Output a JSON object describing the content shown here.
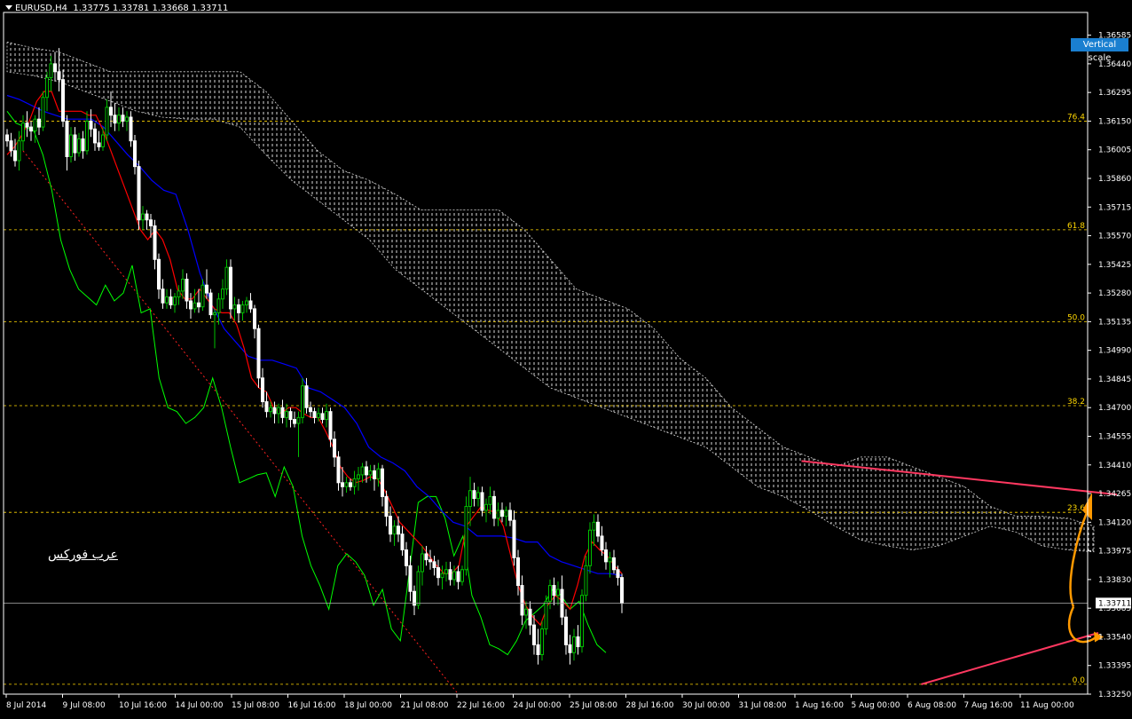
{
  "header": {
    "symbol": "EURUSD,H4",
    "ohlc": "1.33775 1.33781 1.33668 1.33711"
  },
  "vertical_scale_label": "Vertical scale",
  "watermark": "عرب فوركس",
  "colors": {
    "bg": "#000000",
    "bull": "#00c000",
    "bear": "#ffffff",
    "axis": "#ffffff",
    "tenkan": "#ff0000",
    "kijun": "#0000ff",
    "chikou": "#00ff00",
    "cloud": "#ffffff",
    "fib": "#ffd700",
    "trend": "#ff3860",
    "diag": "#ff2020",
    "arrow": "#ff9900",
    "price_line": "#b0b0b0"
  },
  "chart_data": {
    "type": "candlestick",
    "symbol": "EURUSD",
    "timeframe": "H4",
    "ylim": [
      1.3325,
      1.367
    ],
    "y_ticks": [
      1.36585,
      1.3644,
      1.36295,
      1.3615,
      1.36005,
      1.3586,
      1.35715,
      1.3557,
      1.35425,
      1.3528,
      1.35135,
      1.3499,
      1.34845,
      1.347,
      1.34555,
      1.3441,
      1.34265,
      1.3412,
      1.33975,
      1.3383,
      1.33685,
      1.3354,
      1.33395,
      1.3325
    ],
    "y_tick_labels": [
      "1.36585",
      "1.36440",
      "1.36295",
      "1.36150",
      "1.36005",
      "1.35860",
      "1.35715",
      "1.35570",
      "1.35425",
      "1.35280",
      "1.35135",
      "1.34990",
      "1.34845",
      "1.34700",
      "1.34555",
      "1.34410",
      "1.34265",
      "1.34120",
      "1.33975",
      "1.33830",
      "1.33685",
      "1.33540",
      "1.33395",
      "1.33250"
    ],
    "x_labels": [
      "8 Jul 2014",
      "9 Jul 08:00",
      "10 Jul 16:00",
      "14 Jul 00:00",
      "15 Jul 08:00",
      "16 Jul 16:00",
      "18 Jul 00:00",
      "21 Jul 08:00",
      "22 Jul 16:00",
      "24 Jul 00:00",
      "25 Jul 08:00",
      "28 Jul 16:00",
      "30 Jul 00:00",
      "31 Jul 08:00",
      "1 Aug 16:00",
      "5 Aug 00:00",
      "6 Aug 08:00",
      "7 Aug 16:00",
      "11 Aug 00:00"
    ],
    "current_price": 1.33711,
    "current_price_label": "1.33711",
    "fibonacci": {
      "levels": [
        {
          "label": "76.4",
          "price": 1.3615
        },
        {
          "label": "61.8",
          "price": 1.356
        },
        {
          "label": "50.0",
          "price": 1.35135
        },
        {
          "label": "38.2",
          "price": 1.3471
        },
        {
          "label": "23.6",
          "price": 1.3417
        },
        {
          "label": "0.0",
          "price": 1.333
        }
      ]
    },
    "candles": [
      [
        1.3608,
        1.3611,
        1.3602,
        1.3605
      ],
      [
        1.3605,
        1.3609,
        1.3597,
        1.36
      ],
      [
        1.36,
        1.3606,
        1.3592,
        1.3595
      ],
      [
        1.3595,
        1.361,
        1.359,
        1.3605
      ],
      [
        1.3605,
        1.3618,
        1.36,
        1.3614
      ],
      [
        1.3614,
        1.362,
        1.3607,
        1.3612
      ],
      [
        1.3612,
        1.3615,
        1.3605,
        1.361
      ],
      [
        1.361,
        1.3618,
        1.3604,
        1.3616
      ],
      [
        1.3616,
        1.3622,
        1.3608,
        1.3612
      ],
      [
        1.3612,
        1.363,
        1.361,
        1.3627
      ],
      [
        1.3627,
        1.364,
        1.362,
        1.3637
      ],
      [
        1.3637,
        1.3648,
        1.363,
        1.3644
      ],
      [
        1.3644,
        1.365,
        1.3635,
        1.364
      ],
      [
        1.364,
        1.3652,
        1.363,
        1.3636
      ],
      [
        1.3636,
        1.3641,
        1.3612,
        1.3615
      ],
      [
        1.3615,
        1.3618,
        1.359,
        1.3597
      ],
      [
        1.3597,
        1.3612,
        1.3594,
        1.3608
      ],
      [
        1.3608,
        1.3612,
        1.3595,
        1.3599
      ],
      [
        1.3599,
        1.3609,
        1.3597,
        1.3606
      ],
      [
        1.3606,
        1.361,
        1.3596,
        1.36
      ],
      [
        1.36,
        1.362,
        1.3598,
        1.3615
      ],
      [
        1.3615,
        1.3621,
        1.3607,
        1.3611
      ],
      [
        1.3611,
        1.3614,
        1.36,
        1.3604
      ],
      [
        1.3604,
        1.361,
        1.36,
        1.3602
      ],
      [
        1.3602,
        1.3612,
        1.36,
        1.3608
      ],
      [
        1.3608,
        1.3626,
        1.3605,
        1.3622
      ],
      [
        1.3622,
        1.363,
        1.3612,
        1.3618
      ],
      [
        1.3618,
        1.3624,
        1.361,
        1.3614
      ],
      [
        1.3614,
        1.3622,
        1.361,
        1.3618
      ],
      [
        1.3618,
        1.3622,
        1.3612,
        1.3615
      ],
      [
        1.3615,
        1.362,
        1.361,
        1.3617
      ],
      [
        1.3617,
        1.362,
        1.3602,
        1.3605
      ],
      [
        1.3605,
        1.3608,
        1.3588,
        1.3592
      ],
      [
        1.3592,
        1.3595,
        1.356,
        1.3565
      ],
      [
        1.3565,
        1.3572,
        1.356,
        1.3568
      ],
      [
        1.3568,
        1.357,
        1.356,
        1.3565
      ],
      [
        1.3565,
        1.3568,
        1.3556,
        1.3562
      ],
      [
        1.3562,
        1.3565,
        1.354,
        1.3545
      ],
      [
        1.3545,
        1.3548,
        1.3525,
        1.353
      ],
      [
        1.353,
        1.3535,
        1.352,
        1.3523
      ],
      [
        1.3523,
        1.353,
        1.352,
        1.3526
      ],
      [
        1.3526,
        1.353,
        1.352,
        1.3522
      ],
      [
        1.3522,
        1.3528,
        1.3518,
        1.3526
      ],
      [
        1.3526,
        1.3532,
        1.3522,
        1.3529
      ],
      [
        1.3529,
        1.354,
        1.3525,
        1.3535
      ],
      [
        1.3535,
        1.3538,
        1.352,
        1.3524
      ],
      [
        1.3524,
        1.3528,
        1.3515,
        1.352
      ],
      [
        1.352,
        1.353,
        1.3518,
        1.3523
      ],
      [
        1.3523,
        1.353,
        1.3518,
        1.3521
      ],
      [
        1.3521,
        1.3535,
        1.3519,
        1.3532
      ],
      [
        1.3532,
        1.354,
        1.3525,
        1.3528
      ],
      [
        1.3528,
        1.353,
        1.3515,
        1.3517
      ],
      [
        1.3517,
        1.352,
        1.35,
        1.3518
      ],
      [
        1.3518,
        1.3528,
        1.3512,
        1.3525
      ],
      [
        1.3525,
        1.3535,
        1.352,
        1.353
      ],
      [
        1.353,
        1.3545,
        1.3527,
        1.3541
      ],
      [
        1.3541,
        1.3545,
        1.3515,
        1.352
      ],
      [
        1.352,
        1.3526,
        1.3514,
        1.3522
      ],
      [
        1.3522,
        1.3525,
        1.3513,
        1.3518
      ],
      [
        1.3518,
        1.3524,
        1.3514,
        1.3522
      ],
      [
        1.3522,
        1.3526,
        1.3518,
        1.3524
      ],
      [
        1.3524,
        1.3528,
        1.3518,
        1.352
      ],
      [
        1.352,
        1.3522,
        1.3505,
        1.351
      ],
      [
        1.351,
        1.3512,
        1.348,
        1.3485
      ],
      [
        1.3485,
        1.349,
        1.347,
        1.3473
      ],
      [
        1.3473,
        1.3478,
        1.3465,
        1.3468
      ],
      [
        1.3468,
        1.3473,
        1.3465,
        1.347
      ],
      [
        1.347,
        1.3473,
        1.3462,
        1.3467
      ],
      [
        1.3467,
        1.3472,
        1.3462,
        1.347
      ],
      [
        1.347,
        1.3474,
        1.3462,
        1.3465
      ],
      [
        1.3465,
        1.3472,
        1.346,
        1.3468
      ],
      [
        1.3468,
        1.347,
        1.346,
        1.3464
      ],
      [
        1.3464,
        1.3468,
        1.346,
        1.3462
      ],
      [
        1.3462,
        1.3468,
        1.3445,
        1.3465
      ],
      [
        1.3465,
        1.3485,
        1.3462,
        1.3481
      ],
      [
        1.3481,
        1.3485,
        1.3467,
        1.347
      ],
      [
        1.347,
        1.3473,
        1.3465,
        1.3468
      ],
      [
        1.3468,
        1.347,
        1.3462,
        1.3465
      ],
      [
        1.3465,
        1.347,
        1.3463,
        1.3467
      ],
      [
        1.3467,
        1.347,
        1.3462,
        1.3464
      ],
      [
        1.3464,
        1.3472,
        1.346,
        1.3468
      ],
      [
        1.3468,
        1.347,
        1.345,
        1.3454
      ],
      [
        1.3454,
        1.3458,
        1.344,
        1.3445
      ],
      [
        1.3445,
        1.3448,
        1.3428,
        1.3432
      ],
      [
        1.3432,
        1.344,
        1.3425,
        1.343
      ],
      [
        1.343,
        1.3435,
        1.3427,
        1.3432
      ],
      [
        1.3432,
        1.3434,
        1.3428,
        1.343
      ],
      [
        1.343,
        1.3438,
        1.3426,
        1.3434
      ],
      [
        1.3434,
        1.344,
        1.3428,
        1.3436
      ],
      [
        1.3436,
        1.3442,
        1.3432,
        1.344
      ],
      [
        1.344,
        1.3443,
        1.3432,
        1.3436
      ],
      [
        1.3436,
        1.3441,
        1.3433,
        1.3438
      ],
      [
        1.3438,
        1.3441,
        1.3428,
        1.3434
      ],
      [
        1.3434,
        1.3442,
        1.343,
        1.3439
      ],
      [
        1.3439,
        1.3441,
        1.342,
        1.3425
      ],
      [
        1.3425,
        1.3428,
        1.341,
        1.3415
      ],
      [
        1.3415,
        1.342,
        1.3402,
        1.3406
      ],
      [
        1.3406,
        1.3413,
        1.34,
        1.341
      ],
      [
        1.341,
        1.3415,
        1.3402,
        1.3406
      ],
      [
        1.3406,
        1.341,
        1.3395,
        1.3398
      ],
      [
        1.3398,
        1.3402,
        1.3385,
        1.339
      ],
      [
        1.339,
        1.3395,
        1.3372,
        1.3377
      ],
      [
        1.3377,
        1.338,
        1.3365,
        1.337
      ],
      [
        1.337,
        1.339,
        1.3368,
        1.3387
      ],
      [
        1.3387,
        1.34,
        1.338,
        1.3396
      ],
      [
        1.3396,
        1.34,
        1.339,
        1.3393
      ],
      [
        1.3393,
        1.3398,
        1.3388,
        1.3392
      ],
      [
        1.3392,
        1.3395,
        1.3385,
        1.3389
      ],
      [
        1.3389,
        1.3393,
        1.338,
        1.3384
      ],
      [
        1.3384,
        1.339,
        1.3378,
        1.3386
      ],
      [
        1.3386,
        1.3392,
        1.3382,
        1.3388
      ],
      [
        1.3388,
        1.3392,
        1.338,
        1.3383
      ],
      [
        1.3383,
        1.339,
        1.338,
        1.3387
      ],
      [
        1.3387,
        1.339,
        1.3378,
        1.3382
      ],
      [
        1.3382,
        1.339,
        1.338,
        1.3388
      ],
      [
        1.3388,
        1.3425,
        1.3385,
        1.342
      ],
      [
        1.342,
        1.3435,
        1.341,
        1.3428
      ],
      [
        1.3428,
        1.3432,
        1.342,
        1.3424
      ],
      [
        1.3424,
        1.343,
        1.342,
        1.3427
      ],
      [
        1.3427,
        1.343,
        1.3415,
        1.3418
      ],
      [
        1.3418,
        1.3424,
        1.3412,
        1.3421
      ],
      [
        1.3421,
        1.343,
        1.3416,
        1.3425
      ],
      [
        1.3425,
        1.3428,
        1.341,
        1.3414
      ],
      [
        1.3414,
        1.3422,
        1.341,
        1.3418
      ],
      [
        1.3418,
        1.3422,
        1.3412,
        1.3415
      ],
      [
        1.3415,
        1.342,
        1.341,
        1.3418
      ],
      [
        1.3418,
        1.3422,
        1.341,
        1.3413
      ],
      [
        1.3413,
        1.3418,
        1.339,
        1.3394
      ],
      [
        1.3394,
        1.3398,
        1.3375,
        1.338
      ],
      [
        1.338,
        1.3385,
        1.336,
        1.3365
      ],
      [
        1.3365,
        1.3372,
        1.3358,
        1.3368
      ],
      [
        1.3368,
        1.3372,
        1.3355,
        1.336
      ],
      [
        1.336,
        1.3365,
        1.3345,
        1.335
      ],
      [
        1.335,
        1.3358,
        1.334,
        1.3345
      ],
      [
        1.3345,
        1.3362,
        1.3342,
        1.3358
      ],
      [
        1.3358,
        1.3375,
        1.3355,
        1.3372
      ],
      [
        1.3372,
        1.3383,
        1.3368,
        1.338
      ],
      [
        1.338,
        1.3384,
        1.337,
        1.3375
      ],
      [
        1.3375,
        1.3382,
        1.337,
        1.3378
      ],
      [
        1.3378,
        1.3385,
        1.336,
        1.3364
      ],
      [
        1.3364,
        1.3368,
        1.3345,
        1.335
      ],
      [
        1.335,
        1.3355,
        1.334,
        1.3346
      ],
      [
        1.3346,
        1.3358,
        1.3342,
        1.3354
      ],
      [
        1.3354,
        1.336,
        1.3345,
        1.3349
      ],
      [
        1.3349,
        1.3378,
        1.3346,
        1.3375
      ],
      [
        1.3375,
        1.3395,
        1.3372,
        1.339
      ],
      [
        1.339,
        1.3412,
        1.3386,
        1.3408
      ],
      [
        1.3408,
        1.3416,
        1.34,
        1.3412
      ],
      [
        1.3412,
        1.3416,
        1.3402,
        1.3405
      ],
      [
        1.3405,
        1.341,
        1.3395,
        1.3398
      ],
      [
        1.3398,
        1.3402,
        1.3388,
        1.3392
      ],
      [
        1.3392,
        1.3397,
        1.3384,
        1.3394
      ],
      [
        1.3394,
        1.3398,
        1.3386,
        1.3388
      ],
      [
        1.3388,
        1.339,
        1.338,
        1.3384
      ],
      [
        1.3384,
        1.3386,
        1.3366,
        1.3371
      ]
    ],
    "tenkan": [
      1.3598,
      1.3602,
      1.3608,
      1.3615,
      1.3625,
      1.363,
      1.363,
      1.362,
      1.362,
      1.362,
      1.362,
      1.3618,
      1.3618,
      1.361,
      1.36,
      1.359,
      1.358,
      1.357,
      1.356,
      1.3555,
      1.356,
      1.3555,
      1.3545,
      1.353,
      1.3525,
      1.3525,
      1.353,
      1.3525,
      1.352,
      1.3518,
      1.3518,
      1.3512,
      1.35,
      1.3485,
      1.348,
      1.3478,
      1.347,
      1.3467,
      1.347,
      1.347,
      1.3467,
      1.3465,
      1.3465,
      1.3458,
      1.345,
      1.344,
      1.3435,
      1.3432,
      1.3433,
      1.3435,
      1.3434,
      1.3428,
      1.342,
      1.3412,
      1.3408,
      1.3404,
      1.34,
      1.3395,
      1.339,
      1.3386,
      1.3386,
      1.339,
      1.341,
      1.3415,
      1.342,
      1.3418,
      1.3417,
      1.341,
      1.3395,
      1.338,
      1.337,
      1.3364,
      1.336,
      1.337,
      1.3375,
      1.3372,
      1.3368,
      1.338,
      1.3395,
      1.3402,
      1.3398,
      1.3395,
      1.339,
      1.3386
    ],
    "kijun": [
      1.3628,
      1.3626,
      1.3623,
      1.362,
      1.3618,
      1.3616,
      1.3616,
      1.3616,
      1.3612,
      1.3605,
      1.3598,
      1.3592,
      1.3585,
      1.358,
      1.3578,
      1.356,
      1.3538,
      1.3522,
      1.351,
      1.3503,
      1.3496,
      1.3494,
      1.3494,
      1.3492,
      1.349,
      1.348,
      1.3478,
      1.3474,
      1.347,
      1.3462,
      1.345,
      1.3445,
      1.3442,
      1.3438,
      1.343,
      1.3425,
      1.3418,
      1.3412,
      1.341,
      1.3405,
      1.3405,
      1.3405,
      1.3404,
      1.3402,
      1.3402,
      1.3395,
      1.3392,
      1.339,
      1.3388,
      1.3386,
      1.3386,
      1.3385
    ],
    "chikou": [
      1.362,
      1.3614,
      1.3612,
      1.361,
      1.3598,
      1.358,
      1.3555,
      1.354,
      1.353,
      1.3526,
      1.3522,
      1.3532,
      1.3524,
      1.3528,
      1.3542,
      1.3518,
      1.352,
      1.3485,
      1.347,
      1.3468,
      1.3462,
      1.3465,
      1.347,
      1.3485,
      1.347,
      1.345,
      1.3432,
      1.3434,
      1.3436,
      1.3437,
      1.3425,
      1.344,
      1.343,
      1.3405,
      1.339,
      1.338,
      1.3368,
      1.339,
      1.3396,
      1.3392,
      1.3385,
      1.337,
      1.3378,
      1.3358,
      1.3352,
      1.3387,
      1.3422,
      1.3425,
      1.3425,
      1.3414,
      1.3395,
      1.3405,
      1.3375,
      1.3364,
      1.335,
      1.3348,
      1.3345,
      1.3352,
      1.3362,
      1.3366,
      1.337,
      1.3378,
      1.3375,
      1.3368,
      1.3372,
      1.336,
      1.335,
      1.3346
    ],
    "cloud_upper": [
      1.3655,
      1.3652,
      1.365,
      1.3645,
      1.364,
      1.364,
      1.364,
      1.364,
      1.364,
      1.364,
      1.363,
      1.3615,
      1.36,
      1.359,
      1.3585,
      1.3578,
      1.357,
      1.357,
      1.357,
      1.357,
      1.356,
      1.3545,
      1.353,
      1.3525,
      1.352,
      1.351,
      1.3495,
      1.3485,
      1.347,
      1.346,
      1.345,
      1.3445,
      1.344,
      1.3445,
      1.3445,
      1.344,
      1.3435,
      1.343,
      1.342,
      1.3415,
      1.3415,
      1.3414,
      1.341
    ],
    "cloud_lower": [
      1.364,
      1.3638,
      1.3635,
      1.363,
      1.3625,
      1.362,
      1.3617,
      1.3616,
      1.3616,
      1.3612,
      1.3598,
      1.3585,
      1.3575,
      1.3565,
      1.3555,
      1.354,
      1.353,
      1.352,
      1.351,
      1.35,
      1.349,
      1.348,
      1.3475,
      1.347,
      1.3465,
      1.346,
      1.3455,
      1.345,
      1.344,
      1.343,
      1.3425,
      1.3418,
      1.341,
      1.3403,
      1.34,
      1.3398,
      1.34,
      1.3405,
      1.341,
      1.3407,
      1.34,
      1.3398,
      1.3397
    ]
  }
}
